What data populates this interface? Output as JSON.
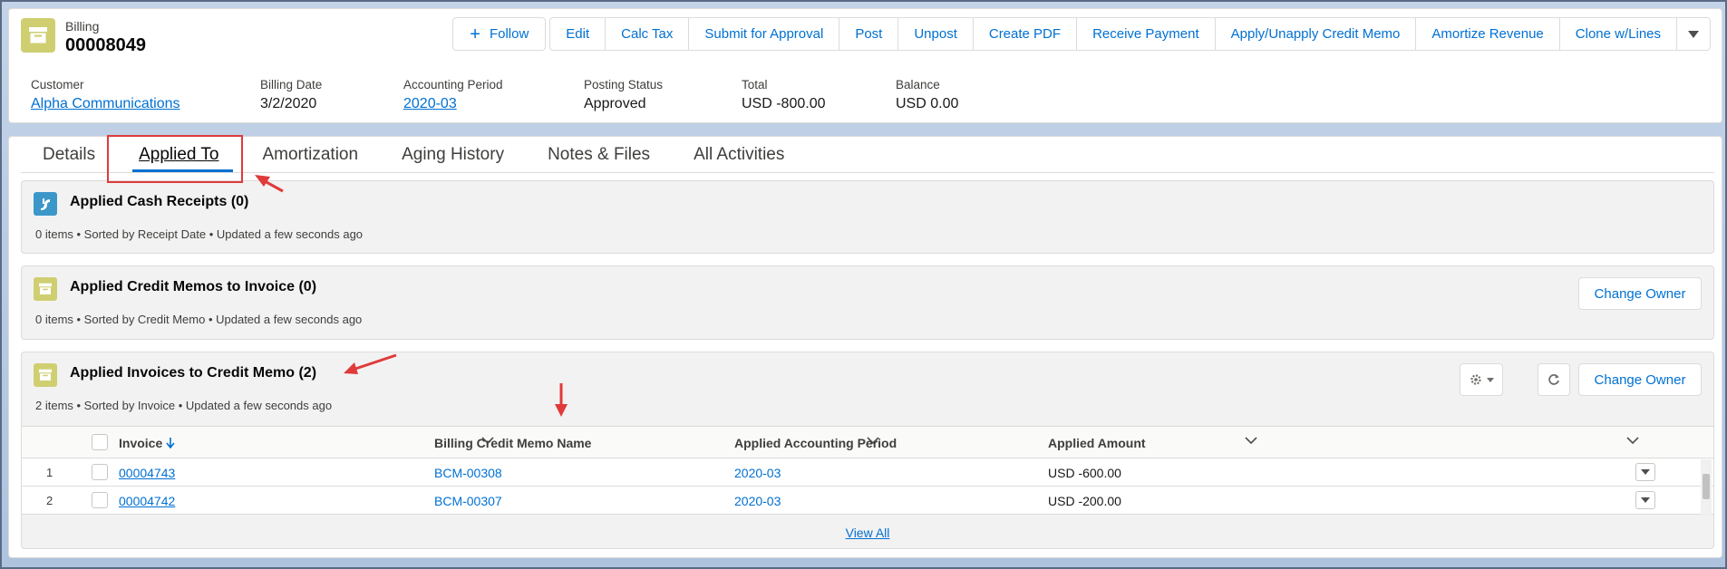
{
  "header": {
    "record_type": "Billing",
    "record_name": "00008049",
    "follow_label": "Follow",
    "actions": [
      "Edit",
      "Calc Tax",
      "Submit for Approval",
      "Post",
      "Unpost",
      "Create PDF",
      "Receive Payment",
      "Apply/Unapply Credit Memo",
      "Amortize Revenue",
      "Clone w/Lines"
    ],
    "highlights": [
      {
        "label": "Customer",
        "value": "Alpha Communications",
        "link": true
      },
      {
        "label": "Billing Date",
        "value": "3/2/2020",
        "link": false
      },
      {
        "label": "Accounting Period",
        "value": "2020-03",
        "link": true
      },
      {
        "label": "Posting Status",
        "value": "Approved",
        "link": false
      },
      {
        "label": "Total",
        "value": "USD -800.00",
        "link": false
      },
      {
        "label": "Balance",
        "value": "USD 0.00",
        "link": false
      }
    ]
  },
  "tabs": [
    "Details",
    "Applied To",
    "Amortization",
    "Aging History",
    "Notes & Files",
    "All Activities"
  ],
  "active_tab": "Applied To",
  "related": {
    "cash_receipts": {
      "title": "Applied Cash Receipts (0)",
      "subtitle": "0 items • Sorted by Receipt Date • Updated a few seconds ago"
    },
    "credit_memos_to_invoice": {
      "title": "Applied Credit Memos to Invoice (0)",
      "subtitle": "0 items • Sorted by Credit Memo • Updated a few seconds ago",
      "owner_button": "Change Owner"
    },
    "invoices_to_credit_memo": {
      "title": "Applied Invoices to Credit Memo (2)",
      "subtitle": "2 items • Sorted by Invoice • Updated a few seconds ago",
      "owner_button": "Change Owner",
      "columns": [
        "Invoice",
        "Billing Credit Memo Name",
        "Applied Accounting Period",
        "Applied Amount"
      ],
      "rows": [
        {
          "num": "1",
          "invoice": "00004743",
          "memo": "BCM-00308",
          "period": "2020-03",
          "amount": "USD -600.00"
        },
        {
          "num": "2",
          "invoice": "00004742",
          "memo": "BCM-00307",
          "period": "2020-03",
          "amount": "USD -200.00"
        }
      ],
      "view_all": "View All"
    }
  },
  "colors": {
    "link": "#0070d2",
    "billing_icon": "#cfcf72",
    "cash_receipt_icon": "#3c97c9",
    "annotation": "#e03a3a"
  }
}
